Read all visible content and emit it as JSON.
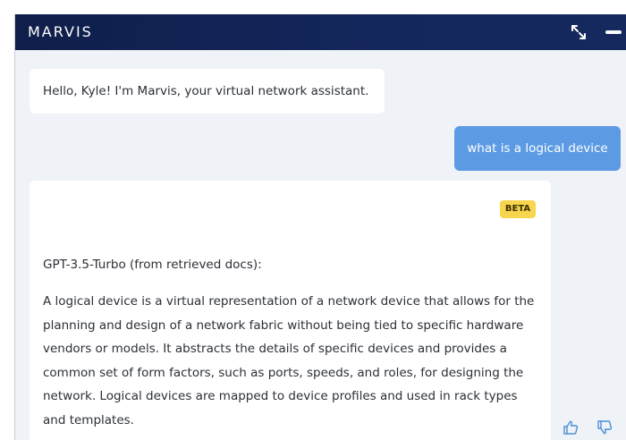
{
  "window": {
    "title": "MARVIS",
    "expand_icon": "expand-arrows-icon",
    "minimize_icon": "minimize-icon"
  },
  "messages": {
    "greeting": "Hello, Kyle! I'm Marvis, your virtual network assistant.",
    "user_query": "what is a logical device",
    "answer": {
      "badge": "BETA",
      "model_label": "GPT-3.5-Turbo (from retrieved docs):",
      "text": "A logical device is a virtual representation of a network device that allows for the planning and design of a network fabric without being tied to specific hardware vendors or models. It abstracts the details of specific devices and provides a common set of form factors, such as ports, speeds, and roles, for designing the network. Logical devices are mapped to device profiles and used in rack types and templates."
    }
  },
  "feedback": {
    "up_icon": "thumbs-up-icon",
    "down_icon": "thumbs-down-icon"
  },
  "colors": {
    "titlebar": "#14275c",
    "user_bubble": "#5c9be3",
    "badge": "#f7d54c",
    "background": "#eff2f6",
    "feedback_icon": "#4a8fd9"
  }
}
